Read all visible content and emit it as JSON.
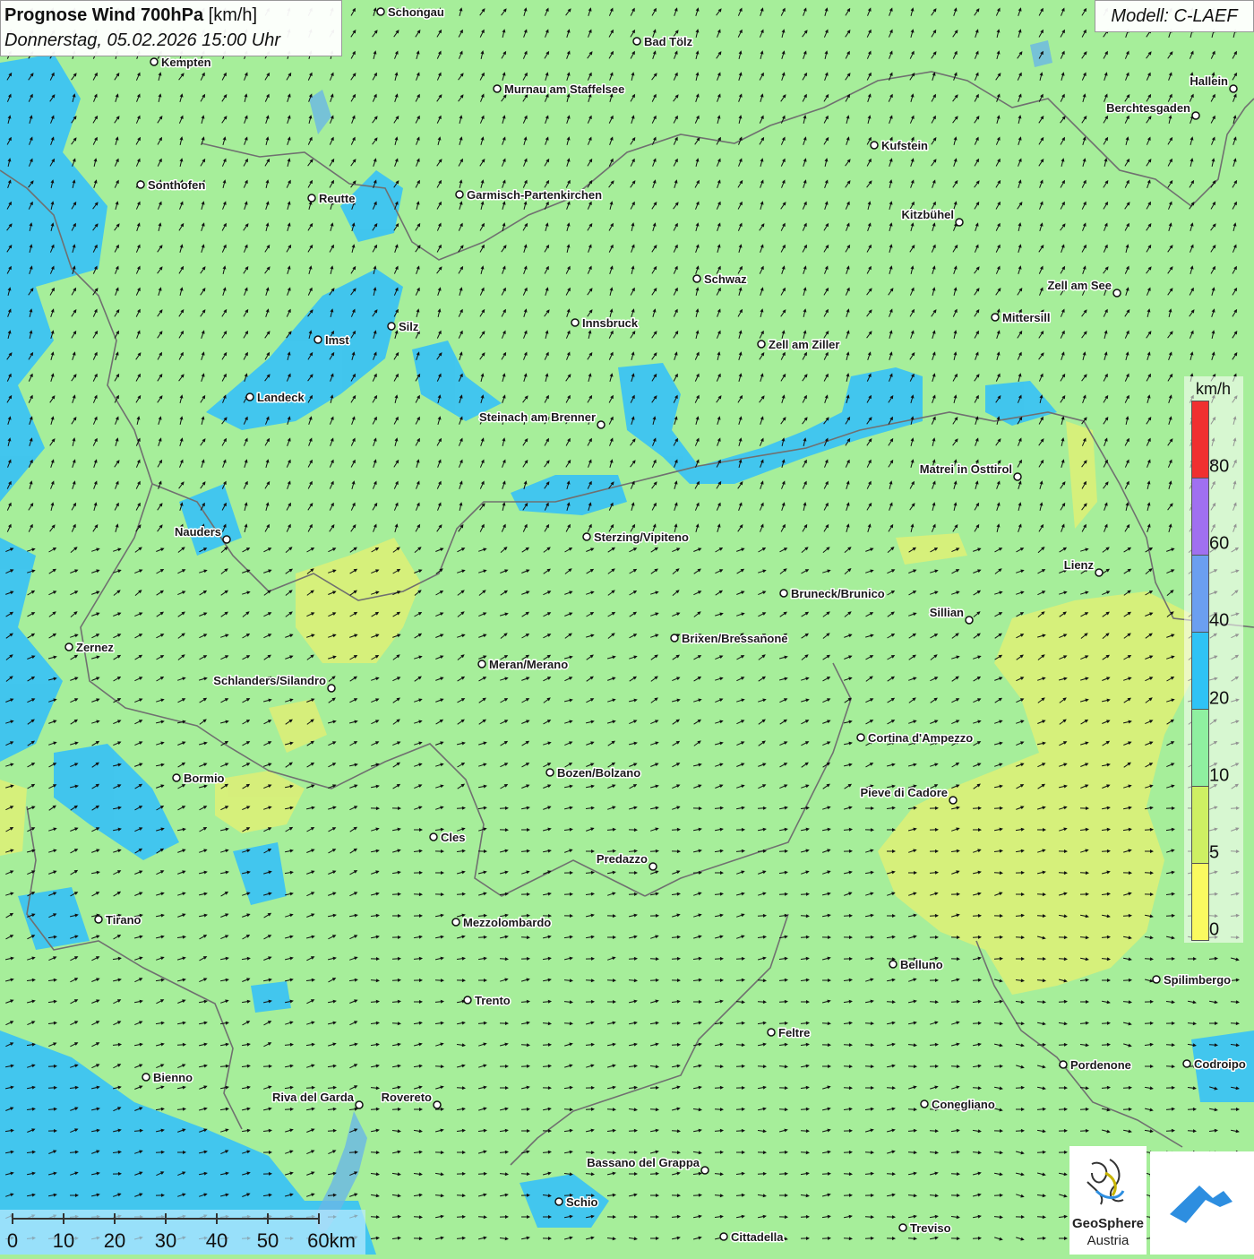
{
  "title": {
    "bold": "Prognose Wind 700hPa",
    "unit": "[km/h]",
    "datetime": "Donnerstag, 05.02.2026 15:00 Uhr"
  },
  "model_label": "Modell: C-LAEF",
  "legend": {
    "unit": "km/h",
    "labels": [
      "80",
      "60",
      "40",
      "20",
      "10",
      "5",
      "0"
    ],
    "colors": [
      "#f03030",
      "#a070f0",
      "#6b9ff0",
      "#2fc3f5",
      "#8ff0a0",
      "#cef063",
      "#fafa60"
    ]
  },
  "scale": {
    "labels": [
      "0",
      "10",
      "20",
      "30",
      "40",
      "50",
      "60km"
    ]
  },
  "logo": {
    "name": "GeoSphere",
    "country": "Austria"
  },
  "colors": {
    "background": "#a6ee9a",
    "wind_blue": "#3cc3f2",
    "wind_yellow": "#dcef78",
    "border": "#707070",
    "brand_blue": "#2d8ee0"
  },
  "cities": [
    {
      "name": "Schongau"
    },
    {
      "name": "Bad Tölz"
    },
    {
      "name": "Kempten"
    },
    {
      "name": "Murnau am Staffelsee"
    },
    {
      "name": "Hallein"
    },
    {
      "name": "Berchtesgaden"
    },
    {
      "name": "Kufstein"
    },
    {
      "name": "Sonthofen"
    },
    {
      "name": "Reutte"
    },
    {
      "name": "Garmisch-Partenkirchen"
    },
    {
      "name": "Kitzbühel"
    },
    {
      "name": "Schwaz"
    },
    {
      "name": "Zell am See"
    },
    {
      "name": "Mittersill"
    },
    {
      "name": "Innsbruck"
    },
    {
      "name": "Silz"
    },
    {
      "name": "Imst"
    },
    {
      "name": "Zell am Ziller"
    },
    {
      "name": "Landeck"
    },
    {
      "name": "Steinach am Brenner"
    },
    {
      "name": "Matrei in Osttirol"
    },
    {
      "name": "Nauders"
    },
    {
      "name": "Sterzing/Vipiteno"
    },
    {
      "name": "Lienz"
    },
    {
      "name": "Bruneck/Brunico"
    },
    {
      "name": "Sillian"
    },
    {
      "name": "Zernez"
    },
    {
      "name": "Brixen/Bressanone"
    },
    {
      "name": "Meran/Merano"
    },
    {
      "name": "Schlanders/Silandro"
    },
    {
      "name": "Cortina d'Ampezzo"
    },
    {
      "name": "Bozen/Bolzano"
    },
    {
      "name": "Bormio"
    },
    {
      "name": "Pieve di Cadore"
    },
    {
      "name": "Cles"
    },
    {
      "name": "Predazzo"
    },
    {
      "name": "Tirano"
    },
    {
      "name": "Mezzolombardo"
    },
    {
      "name": "Belluno"
    },
    {
      "name": "Spilimbergo"
    },
    {
      "name": "Trento"
    },
    {
      "name": "Feltre"
    },
    {
      "name": "Bienno"
    },
    {
      "name": "Pordenone"
    },
    {
      "name": "Codroipo"
    },
    {
      "name": "Riva del Garda"
    },
    {
      "name": "Rovereto"
    },
    {
      "name": "Conegliano"
    },
    {
      "name": "Bassano del Grappa"
    },
    {
      "name": "Schio"
    },
    {
      "name": "Treviso"
    },
    {
      "name": "Cittadella"
    }
  ]
}
